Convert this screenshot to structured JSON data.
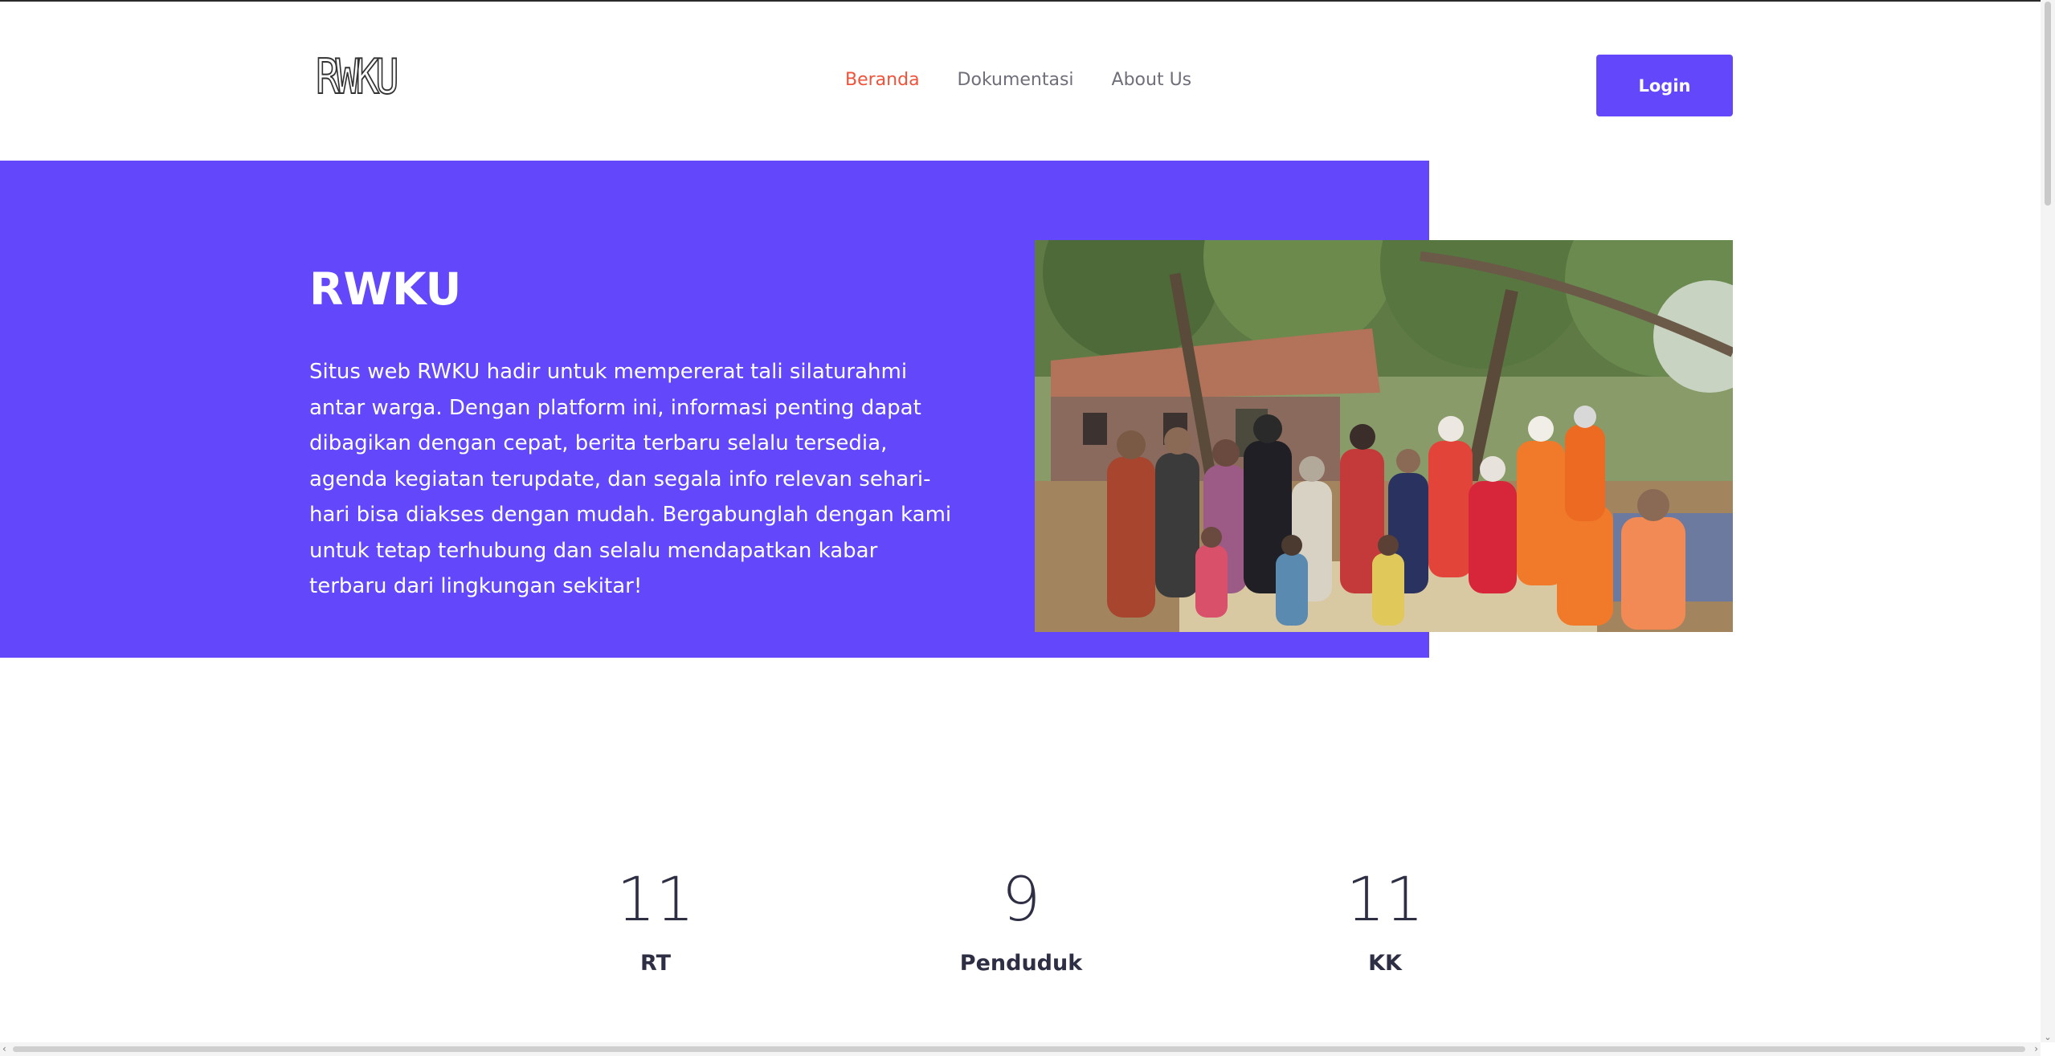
{
  "header": {
    "logo": "RWKU",
    "nav": [
      "Beranda",
      "Dokumentasi",
      "About Us"
    ],
    "active_nav": "Beranda",
    "login_label": "Login"
  },
  "hero": {
    "title": "RWKU",
    "description": "Situs web RWKU hadir untuk mempererat tali silaturahmi antar warga. Dengan platform ini, informasi penting dapat dibagikan dengan cepat, berita terbaru selalu tersedia, agenda kegiatan terupdate, dan segala info relevan sehari-hari bisa diakses dengan mudah. Bergabunglah dengan kami untuk tetap terhubung dan selalu mendapatkan kabar terbaru dari lingkungan sekitar!"
  },
  "stats": [
    {
      "value": "11",
      "label": "RT"
    },
    {
      "value": "9",
      "label": "Penduduk"
    },
    {
      "value": "11",
      "label": "KK"
    }
  ],
  "colors": {
    "brand": "#6247fb",
    "active_nav": "#f0523a",
    "text_dark": "#2e2f45"
  }
}
